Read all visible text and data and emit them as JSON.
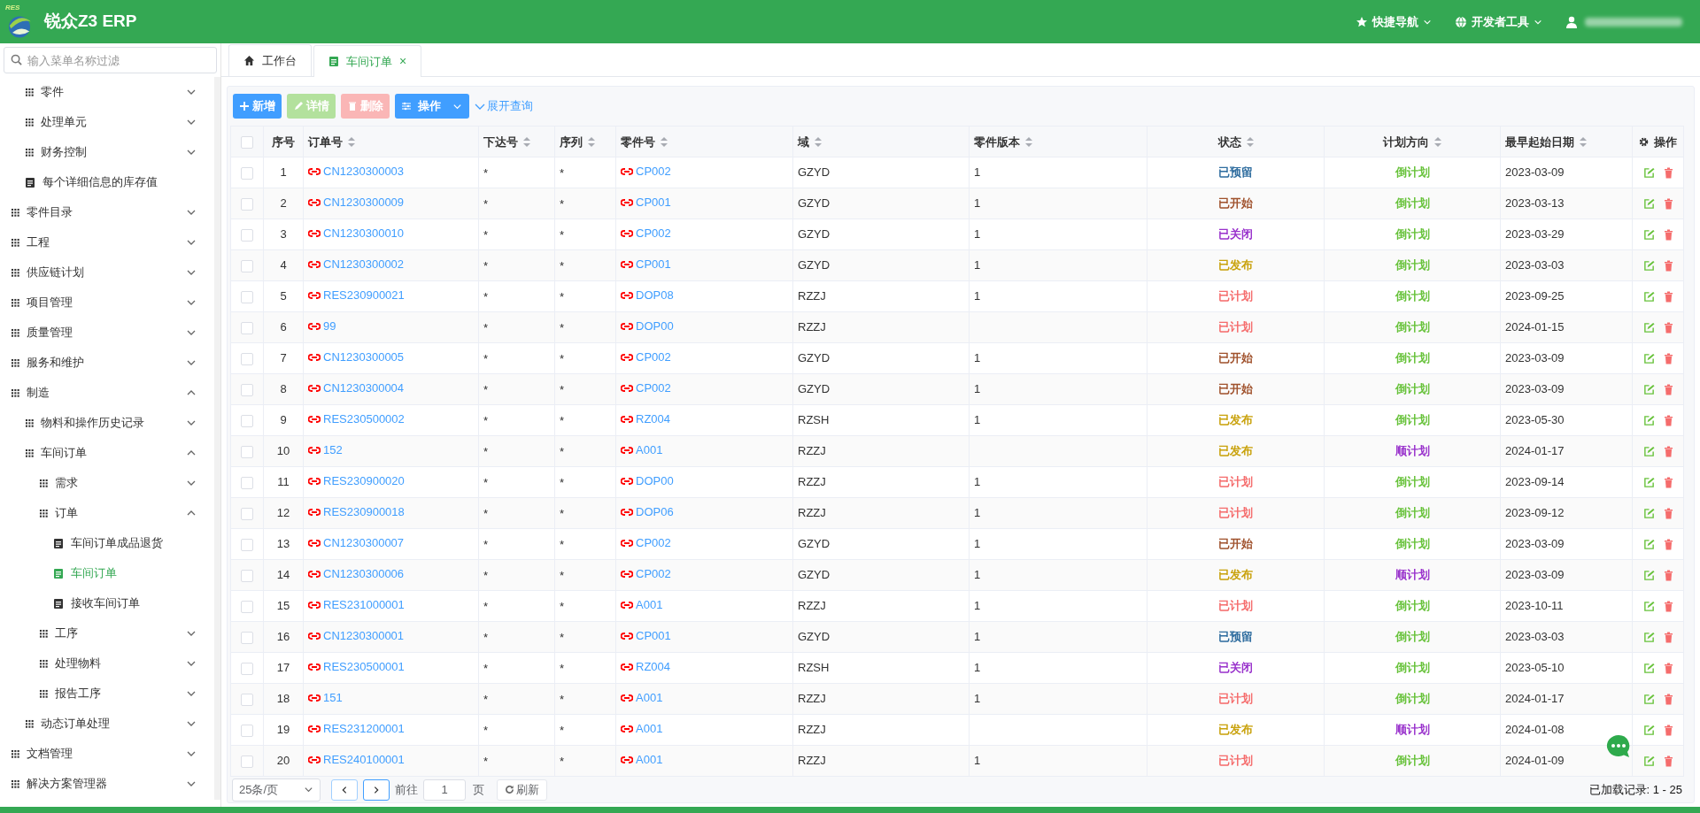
{
  "header": {
    "app_title": "锐众Z3 ERP",
    "logo_text": "RES",
    "menus": [
      {
        "label": "快捷导航",
        "kind": "star"
      },
      {
        "label": "开发者工具",
        "kind": "globe"
      }
    ]
  },
  "sidebar": {
    "search_placeholder": "输入菜单名称过滤",
    "items": [
      {
        "children": [
          {
            "label": "零件",
            "kind": "group",
            "expanded": false,
            "selected": false
          },
          {
            "label": "处理单元",
            "kind": "group",
            "expanded": false,
            "selected": false
          },
          {
            "label": "财务控制",
            "kind": "group",
            "expanded": false,
            "selected": false
          },
          {
            "label": "每个详细信息的库存值",
            "kind": "page",
            "selected": false
          }
        ]
      },
      {
        "label": "零件目录",
        "kind": "group",
        "expanded": false,
        "selected": false
      },
      {
        "label": "工程",
        "kind": "group",
        "expanded": false,
        "selected": false
      },
      {
        "label": "供应链计划",
        "kind": "group",
        "expanded": false,
        "selected": false
      },
      {
        "label": "项目管理",
        "kind": "group",
        "expanded": false,
        "selected": false
      },
      {
        "label": "质量管理",
        "kind": "group",
        "expanded": false,
        "selected": false
      },
      {
        "label": "服务和维护",
        "kind": "group",
        "expanded": false,
        "selected": false
      },
      {
        "label": "制造",
        "kind": "group",
        "expanded": true,
        "selected": false,
        "children": [
          {
            "label": "物料和操作历史记录",
            "kind": "group",
            "expanded": false,
            "selected": false
          },
          {
            "label": "车间订单",
            "kind": "group",
            "expanded": true,
            "selected": false,
            "children": [
              {
                "label": "需求",
                "kind": "group",
                "expanded": false,
                "selected": false
              },
              {
                "label": "订单",
                "kind": "group",
                "expanded": true,
                "selected": false,
                "children": [
                  {
                    "label": "车间订单成品退货",
                    "kind": "page",
                    "selected": false
                  },
                  {
                    "label": "车间订单",
                    "kind": "page",
                    "selected": true
                  },
                  {
                    "label": "接收车间订单",
                    "kind": "page",
                    "selected": false
                  }
                ]
              },
              {
                "label": "工序",
                "kind": "group",
                "expanded": false,
                "selected": false
              },
              {
                "label": "处理物料",
                "kind": "group",
                "expanded": false,
                "selected": false
              },
              {
                "label": "报告工序",
                "kind": "group",
                "expanded": false,
                "selected": false
              }
            ]
          },
          {
            "label": "动态订单处理",
            "kind": "group",
            "expanded": false,
            "selected": false
          }
        ]
      },
      {
        "label": "文档管理",
        "kind": "group",
        "expanded": false,
        "selected": false
      },
      {
        "label": "解决方案管理器",
        "kind": "group",
        "expanded": false,
        "selected": false
      }
    ]
  },
  "tabs": [
    {
      "label": "工作台",
      "kind": "home",
      "selected": false
    },
    {
      "label": "车间订单",
      "kind": "doc",
      "selected": true,
      "closable": true
    }
  ],
  "tab_close": "×",
  "toolbar": [
    {
      "label": "新增",
      "kind": "add",
      "disabled": false
    },
    {
      "label": "详情",
      "kind": "detail",
      "disabled": true
    },
    {
      "label": "删除",
      "kind": "delete",
      "disabled": true
    },
    {
      "label": "操作",
      "kind": "menu",
      "disabled": false
    }
  ],
  "expand_query": "展开查询",
  "table": {
    "columns": [
      {
        "label": "序号",
        "sortable": false
      },
      {
        "label": "订单号",
        "sortable": true
      },
      {
        "label": "下达号",
        "sortable": true
      },
      {
        "label": "序列",
        "sortable": true
      },
      {
        "label": "零件号",
        "sortable": true
      },
      {
        "label": "域",
        "sortable": true
      },
      {
        "label": "零件版本",
        "sortable": true
      },
      {
        "label": "状态",
        "sortable": true
      },
      {
        "label": "计划方向",
        "sortable": true
      },
      {
        "label": "最早起始日期",
        "sortable": true
      },
      {
        "label": "操作",
        "sortable": false
      }
    ],
    "all_selected": false,
    "rows": [
      {
        "no": "1",
        "order": "CN1230300003",
        "release": "*",
        "sequence": "*",
        "part": "CP002",
        "site": "GZYD",
        "revision": "1",
        "status": {
          "text": "已预留",
          "color": "#2f6d9f"
        },
        "direction": {
          "text": "倒计划",
          "color": "#67c23a"
        },
        "start": "2023-03-09",
        "selected": false
      },
      {
        "no": "2",
        "order": "CN1230300009",
        "release": "*",
        "sequence": "*",
        "part": "CP001",
        "site": "GZYD",
        "revision": "1",
        "status": {
          "text": "已开始",
          "color": "#a0522d"
        },
        "direction": {
          "text": "倒计划",
          "color": "#67c23a"
        },
        "start": "2023-03-13",
        "selected": false
      },
      {
        "no": "3",
        "order": "CN1230300010",
        "release": "*",
        "sequence": "*",
        "part": "CP002",
        "site": "GZYD",
        "revision": "1",
        "status": {
          "text": "已关闭",
          "color": "#9932cc"
        },
        "direction": {
          "text": "倒计划",
          "color": "#67c23a"
        },
        "start": "2023-03-29",
        "selected": false
      },
      {
        "no": "4",
        "order": "CN1230300002",
        "release": "*",
        "sequence": "*",
        "part": "CP001",
        "site": "GZYD",
        "revision": "1",
        "status": {
          "text": "已发布",
          "color": "#c9a20c"
        },
        "direction": {
          "text": "倒计划",
          "color": "#67c23a"
        },
        "start": "2023-03-03",
        "selected": false
      },
      {
        "no": "5",
        "order": "RES230900021",
        "release": "*",
        "sequence": "*",
        "part": "DOP08",
        "site": "RZZJ",
        "revision": "1",
        "status": {
          "text": "已计划",
          "color": "#f56c6c"
        },
        "direction": {
          "text": "倒计划",
          "color": "#67c23a"
        },
        "start": "2023-09-25",
        "selected": false
      },
      {
        "no": "6",
        "order": "99",
        "release": "*",
        "sequence": "*",
        "part": "DOP00",
        "site": "RZZJ",
        "status": {
          "text": "已计划",
          "color": "#f56c6c"
        },
        "direction": {
          "text": "倒计划",
          "color": "#67c23a"
        },
        "start": "2024-01-15",
        "selected": false
      },
      {
        "no": "7",
        "order": "CN1230300005",
        "release": "*",
        "sequence": "*",
        "part": "CP002",
        "site": "GZYD",
        "revision": "1",
        "status": {
          "text": "已开始",
          "color": "#a0522d"
        },
        "direction": {
          "text": "倒计划",
          "color": "#67c23a"
        },
        "start": "2023-03-09",
        "selected": false
      },
      {
        "no": "8",
        "order": "CN1230300004",
        "release": "*",
        "sequence": "*",
        "part": "CP002",
        "site": "GZYD",
        "revision": "1",
        "status": {
          "text": "已开始",
          "color": "#a0522d"
        },
        "direction": {
          "text": "倒计划",
          "color": "#67c23a"
        },
        "start": "2023-03-09",
        "selected": false
      },
      {
        "no": "9",
        "order": "RES230500002",
        "release": "*",
        "sequence": "*",
        "part": "RZ004",
        "site": "RZSH",
        "revision": "1",
        "status": {
          "text": "已发布",
          "color": "#c9a20c"
        },
        "direction": {
          "text": "倒计划",
          "color": "#67c23a"
        },
        "start": "2023-05-30",
        "selected": false
      },
      {
        "no": "10",
        "order": "152",
        "release": "*",
        "sequence": "*",
        "part": "A001",
        "site": "RZZJ",
        "status": {
          "text": "已发布",
          "color": "#c9a20c"
        },
        "direction": {
          "text": "顺计划",
          "color": "#9932cc"
        },
        "start": "2024-01-17",
        "selected": false
      },
      {
        "no": "11",
        "order": "RES230900020",
        "release": "*",
        "sequence": "*",
        "part": "DOP00",
        "site": "RZZJ",
        "revision": "1",
        "status": {
          "text": "已计划",
          "color": "#f56c6c"
        },
        "direction": {
          "text": "倒计划",
          "color": "#67c23a"
        },
        "start": "2023-09-14",
        "selected": false
      },
      {
        "no": "12",
        "order": "RES230900018",
        "release": "*",
        "sequence": "*",
        "part": "DOP06",
        "site": "RZZJ",
        "revision": "1",
        "status": {
          "text": "已计划",
          "color": "#f56c6c"
        },
        "direction": {
          "text": "倒计划",
          "color": "#67c23a"
        },
        "start": "2023-09-12",
        "selected": false
      },
      {
        "no": "13",
        "order": "CN1230300007",
        "release": "*",
        "sequence": "*",
        "part": "CP002",
        "site": "GZYD",
        "revision": "1",
        "status": {
          "text": "已开始",
          "color": "#a0522d"
        },
        "direction": {
          "text": "倒计划",
          "color": "#67c23a"
        },
        "start": "2023-03-09",
        "selected": false
      },
      {
        "no": "14",
        "order": "CN1230300006",
        "release": "*",
        "sequence": "*",
        "part": "CP002",
        "site": "GZYD",
        "revision": "1",
        "status": {
          "text": "已发布",
          "color": "#c9a20c"
        },
        "direction": {
          "text": "顺计划",
          "color": "#9932cc"
        },
        "start": "2023-03-09",
        "selected": false
      },
      {
        "no": "15",
        "order": "RES231000001",
        "release": "*",
        "sequence": "*",
        "part": "A001",
        "site": "RZZJ",
        "revision": "1",
        "status": {
          "text": "已计划",
          "color": "#f56c6c"
        },
        "direction": {
          "text": "倒计划",
          "color": "#67c23a"
        },
        "start": "2023-10-11",
        "selected": false
      },
      {
        "no": "16",
        "order": "CN1230300001",
        "release": "*",
        "sequence": "*",
        "part": "CP001",
        "site": "GZYD",
        "revision": "1",
        "status": {
          "text": "已预留",
          "color": "#2f6d9f"
        },
        "direction": {
          "text": "倒计划",
          "color": "#67c23a"
        },
        "start": "2023-03-03",
        "selected": false
      },
      {
        "no": "17",
        "order": "RES230500001",
        "release": "*",
        "sequence": "*",
        "part": "RZ004",
        "site": "RZSH",
        "revision": "1",
        "status": {
          "text": "已关闭",
          "color": "#9932cc"
        },
        "direction": {
          "text": "倒计划",
          "color": "#67c23a"
        },
        "start": "2023-05-10",
        "selected": false
      },
      {
        "no": "18",
        "order": "151",
        "release": "*",
        "sequence": "*",
        "part": "A001",
        "site": "RZZJ",
        "revision": "1",
        "status": {
          "text": "已计划",
          "color": "#f56c6c"
        },
        "direction": {
          "text": "倒计划",
          "color": "#67c23a"
        },
        "start": "2024-01-17",
        "selected": false
      },
      {
        "no": "19",
        "order": "RES231200001",
        "release": "*",
        "sequence": "*",
        "part": "A001",
        "site": "RZZJ",
        "status": {
          "text": "已发布",
          "color": "#c9a20c"
        },
        "direction": {
          "text": "顺计划",
          "color": "#9932cc"
        },
        "start": "2024-01-08",
        "selected": false
      },
      {
        "no": "20",
        "order": "RES240100001",
        "release": "*",
        "sequence": "*",
        "part": "A001",
        "site": "RZZJ",
        "revision": "1",
        "status": {
          "text": "已计划",
          "color": "#f56c6c"
        },
        "direction": {
          "text": "倒计划",
          "color": "#67c23a"
        },
        "start": "2024-01-09",
        "selected": false
      }
    ]
  },
  "pagination": {
    "page_size": "25条/页",
    "goto_label": "前往",
    "page": "1",
    "page_unit": "页",
    "refresh": "刷新",
    "records": "已加载记录: 1 - 25"
  }
}
